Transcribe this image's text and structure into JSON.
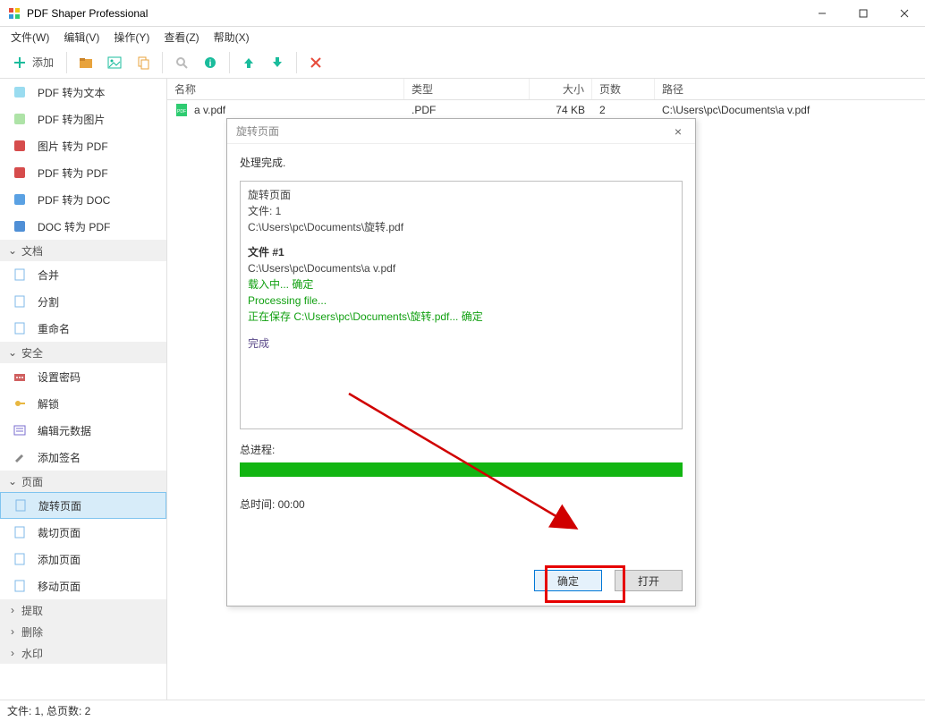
{
  "window": {
    "title": "PDF Shaper Professional"
  },
  "menu": {
    "file": "文件(W)",
    "edit": "编辑(V)",
    "action": "操作(Y)",
    "view": "查看(Z)",
    "help": "帮助(X)"
  },
  "toolbar": {
    "add_label": "添加"
  },
  "sidebar": {
    "items_top": [
      {
        "label": "PDF 转为文本",
        "icon": "txt"
      },
      {
        "label": "PDF 转为图片",
        "icon": "jpg"
      },
      {
        "label": "图片 转为 PDF",
        "icon": "pdf-r"
      },
      {
        "label": "PDF 转为 PDF",
        "icon": "pdf-r"
      },
      {
        "label": "PDF 转为 DOC",
        "icon": "doc"
      },
      {
        "label": "DOC 转为 PDF",
        "icon": "docw"
      }
    ],
    "section_doc": "文档",
    "doc_items": [
      {
        "label": "合并"
      },
      {
        "label": "分割"
      },
      {
        "label": "重命名"
      }
    ],
    "section_sec": "安全",
    "sec_items": [
      {
        "label": "设置密码"
      },
      {
        "label": "解锁"
      },
      {
        "label": "编辑元数据"
      },
      {
        "label": "添加签名"
      }
    ],
    "section_page": "页面",
    "page_items": [
      {
        "label": "旋转页面",
        "selected": true
      },
      {
        "label": "裁切页面"
      },
      {
        "label": "添加页面"
      },
      {
        "label": "移动页面"
      }
    ],
    "section_extract": "提取",
    "section_delete": "删除",
    "section_watermark": "水印"
  },
  "columns": {
    "name": "名称",
    "type": "类型",
    "size": "大小",
    "pages": "页数",
    "path": "路径"
  },
  "files": [
    {
      "name": "a v.pdf",
      "type": ".PDF",
      "size": "74 KB",
      "pages": "2",
      "path": "C:\\Users\\pc\\Documents\\a v.pdf"
    }
  ],
  "statusbar": "文件: 1, 总页数: 2",
  "dialog": {
    "title": "旋转页面",
    "status": "处理完成.",
    "log": {
      "l1": "旋转页面",
      "l2": "文件: 1",
      "l3": "C:\\Users\\pc\\Documents\\旋转.pdf",
      "l4": "文件 #1",
      "l5": "C:\\Users\\pc\\Documents\\a v.pdf",
      "l6": "载入中... 确定",
      "l7": "Processing file...",
      "l8": "正在保存 C:\\Users\\pc\\Documents\\旋转.pdf... 确定",
      "l9": "完成"
    },
    "progress_label": "总进程:",
    "time_label": "总时间: 00:00",
    "ok": "确定",
    "open": "打开"
  }
}
